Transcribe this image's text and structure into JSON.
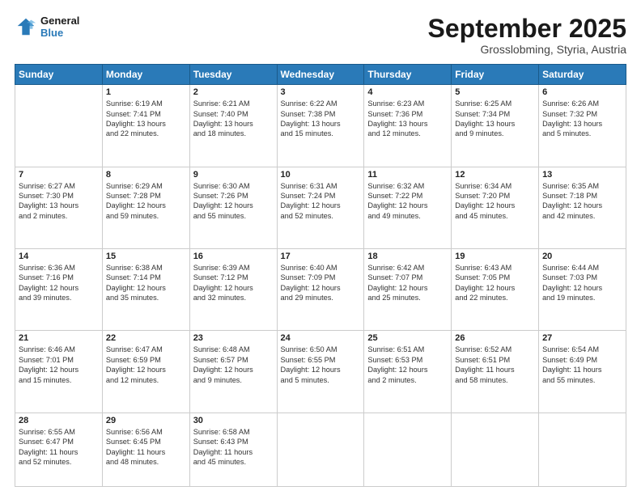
{
  "header": {
    "logo_line1": "General",
    "logo_line2": "Blue",
    "month": "September 2025",
    "location": "Grosslobming, Styria, Austria"
  },
  "weekdays": [
    "Sunday",
    "Monday",
    "Tuesday",
    "Wednesday",
    "Thursday",
    "Friday",
    "Saturday"
  ],
  "weeks": [
    [
      {
        "day": "",
        "text": ""
      },
      {
        "day": "1",
        "text": "Sunrise: 6:19 AM\nSunset: 7:41 PM\nDaylight: 13 hours\nand 22 minutes."
      },
      {
        "day": "2",
        "text": "Sunrise: 6:21 AM\nSunset: 7:40 PM\nDaylight: 13 hours\nand 18 minutes."
      },
      {
        "day": "3",
        "text": "Sunrise: 6:22 AM\nSunset: 7:38 PM\nDaylight: 13 hours\nand 15 minutes."
      },
      {
        "day": "4",
        "text": "Sunrise: 6:23 AM\nSunset: 7:36 PM\nDaylight: 13 hours\nand 12 minutes."
      },
      {
        "day": "5",
        "text": "Sunrise: 6:25 AM\nSunset: 7:34 PM\nDaylight: 13 hours\nand 9 minutes."
      },
      {
        "day": "6",
        "text": "Sunrise: 6:26 AM\nSunset: 7:32 PM\nDaylight: 13 hours\nand 5 minutes."
      }
    ],
    [
      {
        "day": "7",
        "text": "Sunrise: 6:27 AM\nSunset: 7:30 PM\nDaylight: 13 hours\nand 2 minutes."
      },
      {
        "day": "8",
        "text": "Sunrise: 6:29 AM\nSunset: 7:28 PM\nDaylight: 12 hours\nand 59 minutes."
      },
      {
        "day": "9",
        "text": "Sunrise: 6:30 AM\nSunset: 7:26 PM\nDaylight: 12 hours\nand 55 minutes."
      },
      {
        "day": "10",
        "text": "Sunrise: 6:31 AM\nSunset: 7:24 PM\nDaylight: 12 hours\nand 52 minutes."
      },
      {
        "day": "11",
        "text": "Sunrise: 6:32 AM\nSunset: 7:22 PM\nDaylight: 12 hours\nand 49 minutes."
      },
      {
        "day": "12",
        "text": "Sunrise: 6:34 AM\nSunset: 7:20 PM\nDaylight: 12 hours\nand 45 minutes."
      },
      {
        "day": "13",
        "text": "Sunrise: 6:35 AM\nSunset: 7:18 PM\nDaylight: 12 hours\nand 42 minutes."
      }
    ],
    [
      {
        "day": "14",
        "text": "Sunrise: 6:36 AM\nSunset: 7:16 PM\nDaylight: 12 hours\nand 39 minutes."
      },
      {
        "day": "15",
        "text": "Sunrise: 6:38 AM\nSunset: 7:14 PM\nDaylight: 12 hours\nand 35 minutes."
      },
      {
        "day": "16",
        "text": "Sunrise: 6:39 AM\nSunset: 7:12 PM\nDaylight: 12 hours\nand 32 minutes."
      },
      {
        "day": "17",
        "text": "Sunrise: 6:40 AM\nSunset: 7:09 PM\nDaylight: 12 hours\nand 29 minutes."
      },
      {
        "day": "18",
        "text": "Sunrise: 6:42 AM\nSunset: 7:07 PM\nDaylight: 12 hours\nand 25 minutes."
      },
      {
        "day": "19",
        "text": "Sunrise: 6:43 AM\nSunset: 7:05 PM\nDaylight: 12 hours\nand 22 minutes."
      },
      {
        "day": "20",
        "text": "Sunrise: 6:44 AM\nSunset: 7:03 PM\nDaylight: 12 hours\nand 19 minutes."
      }
    ],
    [
      {
        "day": "21",
        "text": "Sunrise: 6:46 AM\nSunset: 7:01 PM\nDaylight: 12 hours\nand 15 minutes."
      },
      {
        "day": "22",
        "text": "Sunrise: 6:47 AM\nSunset: 6:59 PM\nDaylight: 12 hours\nand 12 minutes."
      },
      {
        "day": "23",
        "text": "Sunrise: 6:48 AM\nSunset: 6:57 PM\nDaylight: 12 hours\nand 9 minutes."
      },
      {
        "day": "24",
        "text": "Sunrise: 6:50 AM\nSunset: 6:55 PM\nDaylight: 12 hours\nand 5 minutes."
      },
      {
        "day": "25",
        "text": "Sunrise: 6:51 AM\nSunset: 6:53 PM\nDaylight: 12 hours\nand 2 minutes."
      },
      {
        "day": "26",
        "text": "Sunrise: 6:52 AM\nSunset: 6:51 PM\nDaylight: 11 hours\nand 58 minutes."
      },
      {
        "day": "27",
        "text": "Sunrise: 6:54 AM\nSunset: 6:49 PM\nDaylight: 11 hours\nand 55 minutes."
      }
    ],
    [
      {
        "day": "28",
        "text": "Sunrise: 6:55 AM\nSunset: 6:47 PM\nDaylight: 11 hours\nand 52 minutes."
      },
      {
        "day": "29",
        "text": "Sunrise: 6:56 AM\nSunset: 6:45 PM\nDaylight: 11 hours\nand 48 minutes."
      },
      {
        "day": "30",
        "text": "Sunrise: 6:58 AM\nSunset: 6:43 PM\nDaylight: 11 hours\nand 45 minutes."
      },
      {
        "day": "",
        "text": ""
      },
      {
        "day": "",
        "text": ""
      },
      {
        "day": "",
        "text": ""
      },
      {
        "day": "",
        "text": ""
      }
    ]
  ]
}
